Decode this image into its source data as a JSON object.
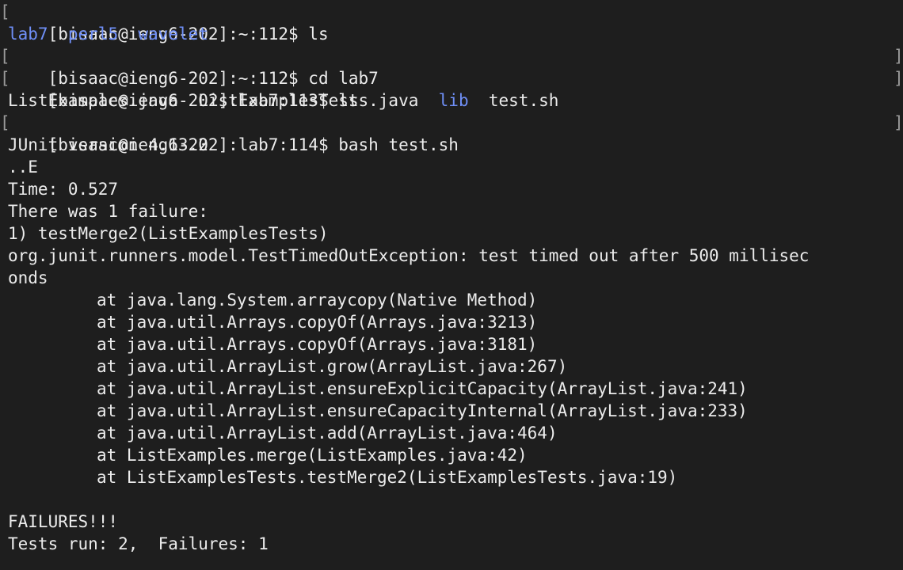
{
  "colors": {
    "background": "#1e1e1e",
    "text": "#ececec",
    "directory": "#6f8ff7",
    "bracket": "#9a9a9a"
  },
  "terminal": {
    "lines": {
      "p1": {
        "open": "[",
        "text": "[bisaac@ieng6-202]:~:112$ ls",
        "close": ""
      },
      "ls1": {
        "d1": "lab7",
        "sep1": "  ",
        "d2": "perl5",
        "sep2": "  ",
        "d3": "wavelet"
      },
      "p2": {
        "open": "[",
        "text": "[bisaac@ieng6-202]:~:112$ cd lab7",
        "close": "]"
      },
      "p3": {
        "open": "[",
        "text": "[bisaac@ieng6-202]:lab7:113$ ls",
        "close": "]"
      },
      "ls2": {
        "f1": "ListExamples.java  ListExamplesTests.java  ",
        "d1": "lib",
        "f2": "  test.sh"
      },
      "p4": {
        "open": "[",
        "text": "[bisaac@ieng6-202]:lab7:114$ bash test.sh",
        "close": "]"
      },
      "junit_version": "JUnit version 4.13.2",
      "progress": "..E",
      "time": "Time: 0.527",
      "failure_header": "There was 1 failure:",
      "failure_item": "1) testMerge2(ListExamplesTests)",
      "exception_1": "org.junit.runners.model.TestTimedOutException: test timed out after 500 millisec",
      "exception_2": "onds",
      "stack": [
        "at java.lang.System.arraycopy(Native Method)",
        "at java.util.Arrays.copyOf(Arrays.java:3213)",
        "at java.util.Arrays.copyOf(Arrays.java:3181)",
        "at java.util.ArrayList.grow(ArrayList.java:267)",
        "at java.util.ArrayList.ensureExplicitCapacity(ArrayList.java:241)",
        "at java.util.ArrayList.ensureCapacityInternal(ArrayList.java:233)",
        "at java.util.ArrayList.add(ArrayList.java:464)",
        "at ListExamples.merge(ListExamples.java:42)",
        "at ListExamplesTests.testMerge2(ListExamplesTests.java:19)"
      ],
      "failures_banner": "FAILURES!!!",
      "summary": "Tests run: 2,  Failures: 1"
    }
  }
}
